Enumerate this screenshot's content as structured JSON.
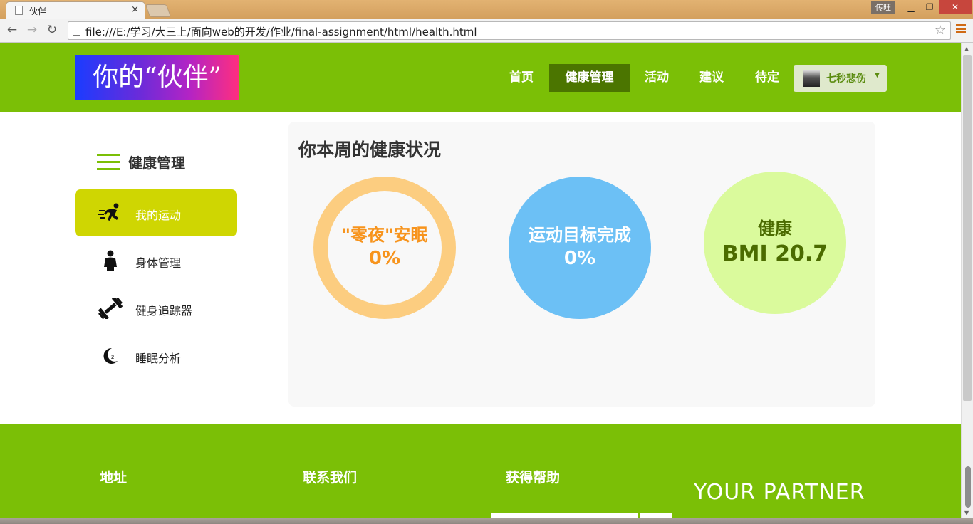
{
  "browser": {
    "tab_title": "伙伴",
    "tab_close": "×",
    "user_badge": "传旺",
    "url": "file:///E:/学习/大三上/面向web的开发/作业/final-assignment/html/health.html",
    "icons": {
      "back": "back-arrow-icon",
      "forward": "forward-arrow-icon",
      "reload": "reload-icon",
      "star": "star-icon",
      "menu": "menu-icon"
    }
  },
  "header": {
    "logo": "你的“伙伴”",
    "nav": [
      {
        "label": "首页"
      },
      {
        "label": "健康管理"
      },
      {
        "label": "活动"
      },
      {
        "label": "建议"
      },
      {
        "label": "待定"
      }
    ],
    "user_name": "七秒悲伤",
    "active_nav": "健康管理"
  },
  "sidebar": {
    "title": "健康管理",
    "items": [
      {
        "label": "我的运动",
        "icon": "running-icon",
        "active": true
      },
      {
        "label": "身体管理",
        "icon": "person-icon",
        "active": false
      },
      {
        "label": "健身追踪器",
        "icon": "dumbbell-icon",
        "active": false
      },
      {
        "label": "睡眠分析",
        "icon": "moon-icon",
        "active": false
      }
    ]
  },
  "panel": {
    "title": "你本周的健康状况",
    "stats": [
      {
        "label": "\"零夜\"安眠",
        "value": "0%",
        "color": "#f7941d"
      },
      {
        "label": "运动目标完成",
        "value": "0%",
        "color": "#ffffff"
      },
      {
        "label": "健康",
        "value": "BMI 20.7",
        "color": "#4b6b00"
      }
    ]
  },
  "footer": {
    "headings": [
      "地址",
      "联系我们",
      "获得帮助"
    ],
    "brand": "YOUR PARTNER"
  },
  "colors": {
    "brand_green": "#7bbf06",
    "active_nav": "#4b7500",
    "sidebar_active": "#cfd602",
    "sleep_ring": "#fccd80",
    "sport_circle": "#6cc0f5",
    "bmi_circle": "#dafa9c"
  }
}
